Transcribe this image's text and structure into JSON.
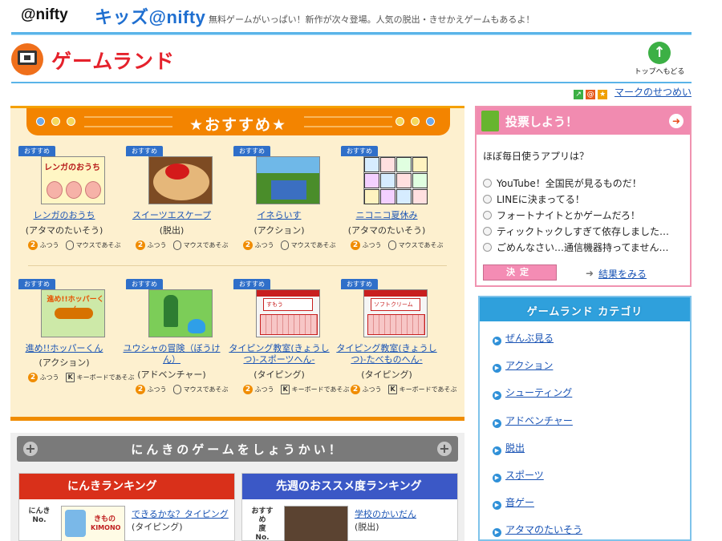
{
  "header": {
    "logo_nifty": "@nifty",
    "logo_kids": "キッズ@nifty",
    "tagline": "無料ゲームがいっぱい！新作が次々登場。人気の脱出・きせかえゲームもあるよ！"
  },
  "title": {
    "page_title": "ゲームランド",
    "top_link": "トップへもどる"
  },
  "mark_link": "マークのせつめい",
  "osusume": {
    "title": "★おすすめ★",
    "ribbon": "おすすめ",
    "games": [
      {
        "name": "レンガのおうち",
        "genre": "(アタマのたいそう)",
        "difficulty": "ふつう",
        "control": "マウスで\nあそぶ",
        "thumb_text": "レンガのおうち"
      },
      {
        "name": "スイーツエスケープ",
        "genre": "(脱出)",
        "difficulty": "ふつう",
        "control": "マウスで\nあそぶ"
      },
      {
        "name": "イネらいす",
        "genre": "(アクション)",
        "difficulty": "ふつう",
        "control": "マウスで\nあそぶ"
      },
      {
        "name": "ニコニコ夏休み",
        "genre": "(アタマのたいそう)",
        "difficulty": "ふつう",
        "control": "マウスで\nあそぶ"
      },
      {
        "name": "進め!!ホッパーくん",
        "genre": "(アクション)",
        "difficulty": "ふつう",
        "control": "キーボードで\nあそぶ",
        "thumb_text": "進め!!ホッパーくん"
      },
      {
        "name": "ユウシャの冒険（ぼうけん）",
        "genre": "(アドベンチャー)",
        "difficulty": "ふつう",
        "control": "マウスで\nあそぶ"
      },
      {
        "name": "タイピング教室(きょうしつ)-スポーツへん-",
        "genre": "(タイピング)",
        "difficulty": "ふつう",
        "control": "キーボードで\nあそぶ",
        "thumb_text": "すもう"
      },
      {
        "name": "タイピング教室(きょうしつ)-たべものへん-",
        "genre": "(タイピング)",
        "difficulty": "ふつう",
        "control": "キーボードで\nあそぶ",
        "thumb_text": "ソフトクリーム"
      }
    ],
    "difficulty_num": "2",
    "key_letter": "K"
  },
  "ninki": {
    "title": "にんきのゲームをしょうかい！",
    "popular_ranking": {
      "heading": "にんきランキング",
      "label": "にんき\nNo.",
      "game": "できるかな？タイピング",
      "genre": "(タイピング)",
      "thumb_text": "きもの",
      "thumb_sub": "KIMONO"
    },
    "weekly_ranking": {
      "heading": "先週のおススメ度ランキング",
      "label": "おすすめ\n度\nNo.",
      "game": "学校のかいだん",
      "genre": "(脱出)"
    }
  },
  "vote": {
    "title": "投票しよう！",
    "question": "ほぼ毎日使うアプリは？",
    "options": [
      "YouTube！全国民が見るものだ！",
      "LINEに決まってる！",
      "フォートナイトとかゲームだろ！",
      "ティックトックしすぎて依存しました…",
      "ごめんなさい…通信機器持ってません…"
    ],
    "submit": "決定",
    "results": "結果をみる"
  },
  "category": {
    "title": "ゲームランド カテゴリ",
    "items": [
      "ぜんぶ見る",
      "アクション",
      "シューティング",
      "アドベンチャー",
      "脱出",
      "スポーツ",
      "音ゲー",
      "アタマのたいそう"
    ]
  },
  "colors": {
    "accent_orange": "#f38400",
    "title_red": "#e5222c",
    "link_blue": "#1a54b5",
    "vote_pink": "#f18bb0",
    "category_blue": "#2fa0dc"
  }
}
